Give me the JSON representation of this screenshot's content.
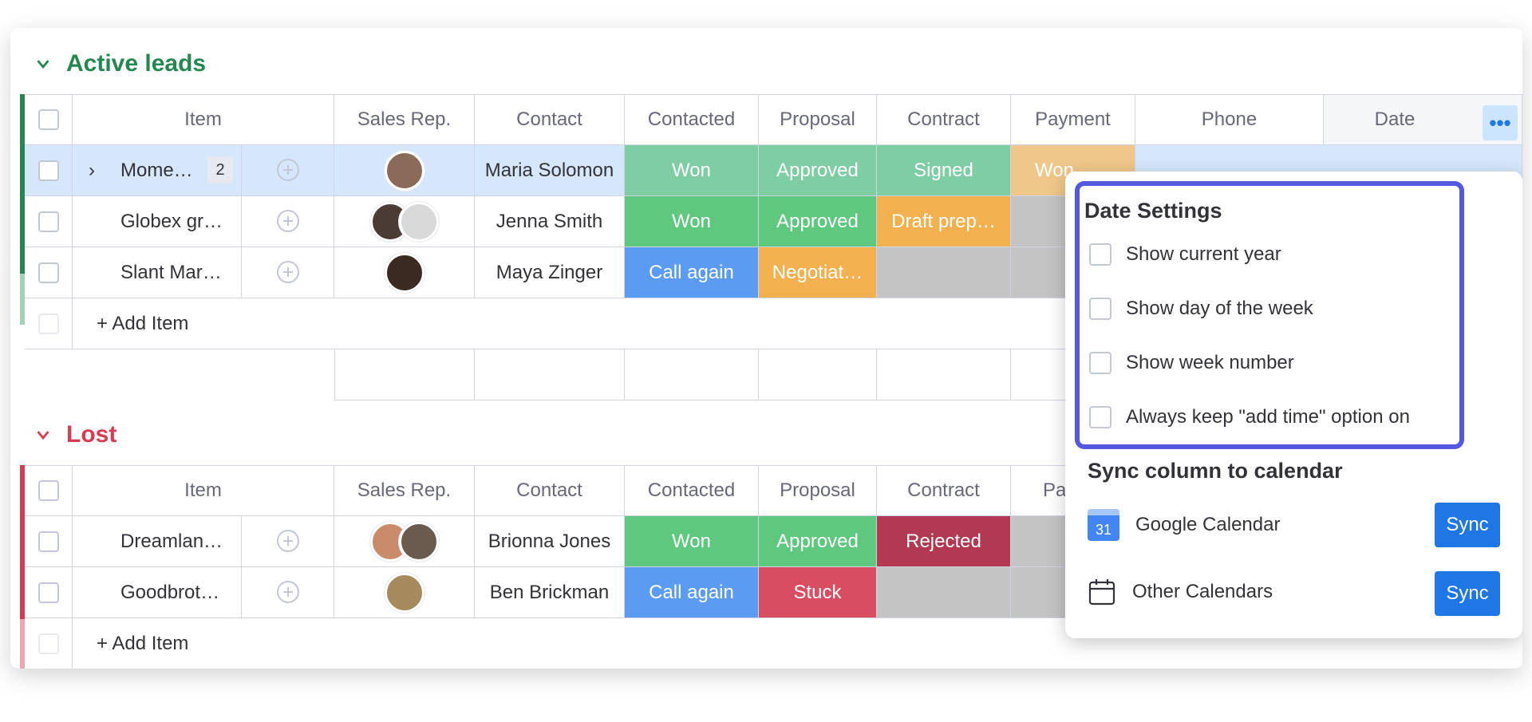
{
  "colors": {
    "won": "#7fcda3",
    "won_solid": "#5ec97e",
    "approved_sel": "#7fcda3",
    "signed": "#7fcda3",
    "approved": "#5ec97e",
    "draft": "#f2b04f",
    "call_again": "#5c9bf2",
    "negotiating": "#f2b04f",
    "rejected": "#b13a52",
    "stuck": "#d84e60",
    "gray": "#c4c4c4",
    "selected_row": "#d6e7fb",
    "accent": "#1f76e5",
    "highlight_border": "#5559df"
  },
  "groups": [
    {
      "title": "Active leads",
      "columns": [
        "Item",
        "Sales Rep.",
        "Contact",
        "Contacted",
        "Proposal",
        "Contract",
        "Payment",
        "Phone",
        "Date"
      ],
      "rows": [
        {
          "item": "Mome…",
          "count": "2",
          "contact": "Maria Solomon",
          "contacted": "Won",
          "proposal": "Approved",
          "contract": "Signed",
          "payment": "Won"
        },
        {
          "item": "Globex gr…",
          "contact": "Jenna Smith",
          "contacted": "Won",
          "proposal": "Approved",
          "contract": "Draft prep…",
          "payment": ""
        },
        {
          "item": "Slant Mar…",
          "contact": "Maya Zinger",
          "contacted": "Call again",
          "proposal": "Negotiat…",
          "contract": "",
          "payment": ""
        }
      ],
      "add_item": "+ Add Item"
    },
    {
      "title": "Lost",
      "columns": [
        "Item",
        "Sales Rep.",
        "Contact",
        "Contacted",
        "Proposal",
        "Contract",
        "Pa"
      ],
      "rows": [
        {
          "item": "Dreamlan…",
          "contact": "Brionna Jones",
          "contacted": "Won",
          "proposal": "Approved",
          "contract": "Rejected"
        },
        {
          "item": "Goodbrot…",
          "contact": "Ben Brickman",
          "contacted": "Call again",
          "proposal": "Stuck",
          "contract": ""
        }
      ],
      "add_item": "+ Add Item"
    }
  ],
  "popup": {
    "title": "Date Settings",
    "options": [
      "Show current year",
      "Show day of the week",
      "Show week number",
      "Always keep \"add time\" option on"
    ],
    "sync_title": "Sync column to calendar",
    "calendars": [
      {
        "name": "Google Calendar",
        "icon": "google-calendar-icon",
        "icon_text": "31",
        "button": "Sync"
      },
      {
        "name": "Other Calendars",
        "icon": "calendar-icon",
        "button": "Sync"
      }
    ]
  },
  "dots": "•••"
}
